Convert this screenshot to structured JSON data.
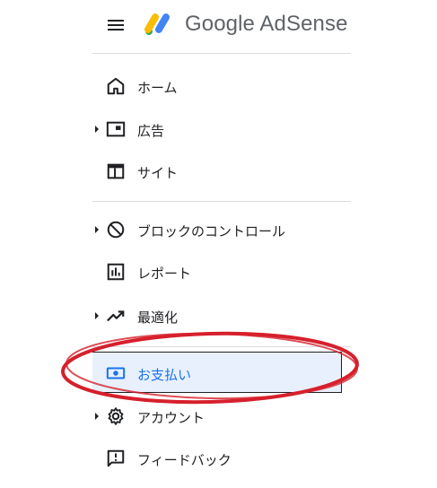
{
  "header": {
    "logo_text": "Google AdSense",
    "menu_icon": "hamburger-menu-icon"
  },
  "nav": {
    "items": [
      {
        "label": "ホーム",
        "icon": "home-icon",
        "expandable": false
      },
      {
        "label": "広告",
        "icon": "ads-icon",
        "expandable": true
      },
      {
        "label": "サイト",
        "icon": "sites-icon",
        "expandable": false
      },
      {
        "label": "ブロックのコントロール",
        "icon": "block-icon",
        "expandable": true
      },
      {
        "label": "レポート",
        "icon": "reports-icon",
        "expandable": false
      },
      {
        "label": "最適化",
        "icon": "optimization-icon",
        "expandable": true
      },
      {
        "label": "お支払い",
        "icon": "payments-icon",
        "expandable": false,
        "selected": true
      },
      {
        "label": "アカウント",
        "icon": "settings-gear-icon",
        "expandable": true
      },
      {
        "label": "フィードバック",
        "icon": "feedback-icon",
        "expandable": false
      }
    ]
  },
  "colors": {
    "active_bg": "#e8f0fe",
    "active_text": "#1a73e8",
    "annotation_red": "#d6202c",
    "logo_blue": "#4285f4",
    "logo_yellow": "#fbbc04",
    "logo_green": "#34a853"
  }
}
